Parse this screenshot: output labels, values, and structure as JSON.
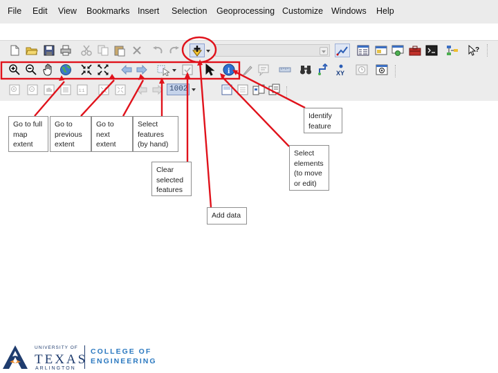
{
  "menu": [
    "File",
    "Edit",
    "View",
    "Bookmarks",
    "Insert",
    "Selection",
    "Geoprocessing",
    "Customize",
    "Windows",
    "Help"
  ],
  "toolbar": {
    "scale_value": "1002",
    "icons": {
      "row1": [
        "new-document-icon",
        "open-folder-icon",
        "save-icon",
        "print-icon",
        "cut-icon",
        "copy-icon",
        "paste-icon",
        "delete-icon",
        "undo-icon",
        "redo-icon",
        "add-data-icon",
        "editor-icon",
        "table-of-contents-icon",
        "catalog-icon",
        "search-window-icon",
        "toolbox-icon",
        "python-icon",
        "model-builder-icon",
        "whats-this-icon"
      ],
      "row2": [
        "zoom-in-icon",
        "zoom-out-icon",
        "pan-hand-icon",
        "full-extent-globe-icon",
        "fixed-zoom-in-icon",
        "fixed-zoom-out-icon",
        "previous-extent-arrow-icon",
        "next-extent-arrow-icon",
        "select-features-icon",
        "clear-selection-icon",
        "select-elements-arrow-icon",
        "identify-icon",
        "html-popup-icon",
        "hyperlink-icon",
        "measure-icon",
        "find-binoculars-icon",
        "route-icon",
        "goto-xy-icon",
        "time-slider-icon",
        "magnifier-window-icon"
      ],
      "row3": [
        "layout-zoom-in-icon",
        "layout-zoom-out-icon",
        "layout-pan-icon",
        "zoom-whole-page-icon",
        "zoom-100-icon",
        "fixed-layout-zoom-icon",
        "layout-prev-icon",
        "layout-next-icon",
        "toggle-draft-icon",
        "focus-data-frame-icon",
        "change-layout-icon",
        "data-driven-pages-icon"
      ]
    }
  },
  "callouts": {
    "full_extent": "Go to full\nmap\nextent",
    "previous_extent": "Go to\nprevious\nextent",
    "next_extent": "Go to\nnext\nextent",
    "select_features": "Select\nfeatures\n(by hand)",
    "clear_selected": "Clear\nselected\nfeatures",
    "add_data": "Add data",
    "select_elements": "Select\nelements\n(to move\nor edit)",
    "identify": "Identify\nfeature"
  },
  "logo": {
    "university": "UNIVERSITY OF",
    "name": "TEXAS",
    "city": "ARLINGTON",
    "college": "COLLEGE OF\nENGINEERING"
  },
  "colors": {
    "annotation": "#e0121b",
    "brand_blue": "#1f3c6e",
    "college_blue": "#2a78c0",
    "menu_bg": "#ebebeb"
  }
}
